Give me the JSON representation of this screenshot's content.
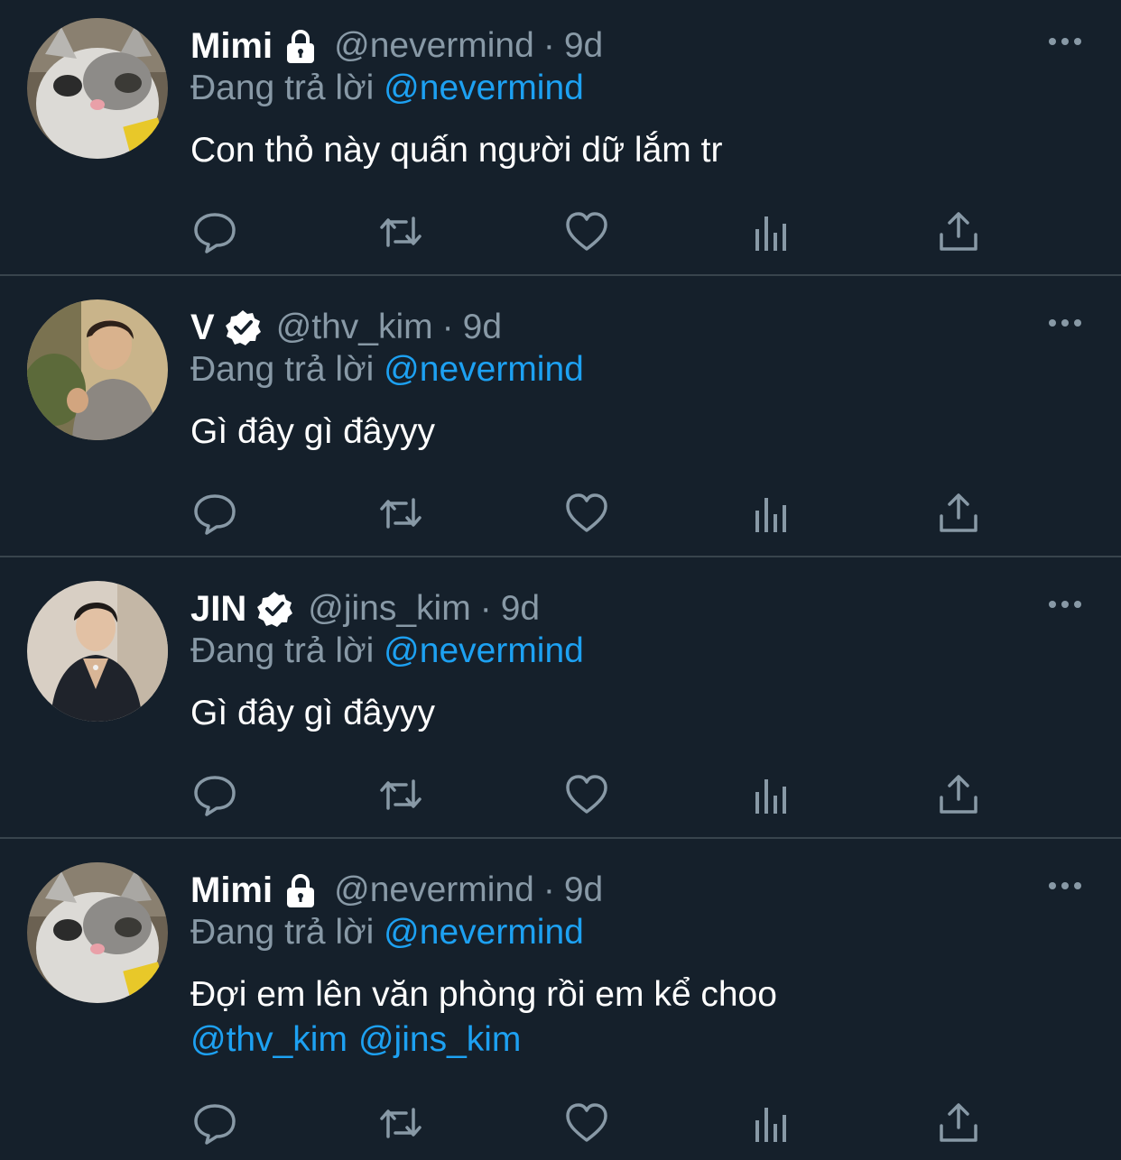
{
  "colors": {
    "background": "#15202b",
    "divider": "#38444d",
    "muted": "#8899a6",
    "link": "#1da1f2",
    "text": "#ffffff"
  },
  "tweets": [
    {
      "display_name": "Mimi",
      "badge": "lock-icon",
      "handle": "@nevermind",
      "separator": "·",
      "time": "9d",
      "reply_label": "Đang trả lời",
      "reply_to": "@nevermind",
      "text": "Con thỏ này quấn người dữ lắm tr"
    },
    {
      "display_name": "V",
      "badge": "verified-icon",
      "handle": "@thv_kim",
      "separator": "·",
      "time": "9d",
      "reply_label": "Đang trả lời",
      "reply_to": "@nevermind",
      "text": "Gì đây gì đâyyy"
    },
    {
      "display_name": "JIN",
      "badge": "verified-icon",
      "handle": "@jins_kim",
      "separator": "·",
      "time": "9d",
      "reply_label": "Đang trả lời",
      "reply_to": "@nevermind",
      "text": "Gì đây gì đâyyy"
    },
    {
      "display_name": "Mimi",
      "badge": "lock-icon",
      "handle": "@nevermind",
      "separator": "·",
      "time": "9d",
      "reply_label": "Đang trả lời",
      "reply_to": "@nevermind",
      "text": "Đợi em lên văn phòng rồi em kể choo",
      "mentions": [
        "@thv_kim",
        "@jins_kim"
      ]
    }
  ],
  "action_icons": [
    "reply-icon",
    "retweet-icon",
    "like-icon",
    "stats-icon",
    "share-icon"
  ]
}
